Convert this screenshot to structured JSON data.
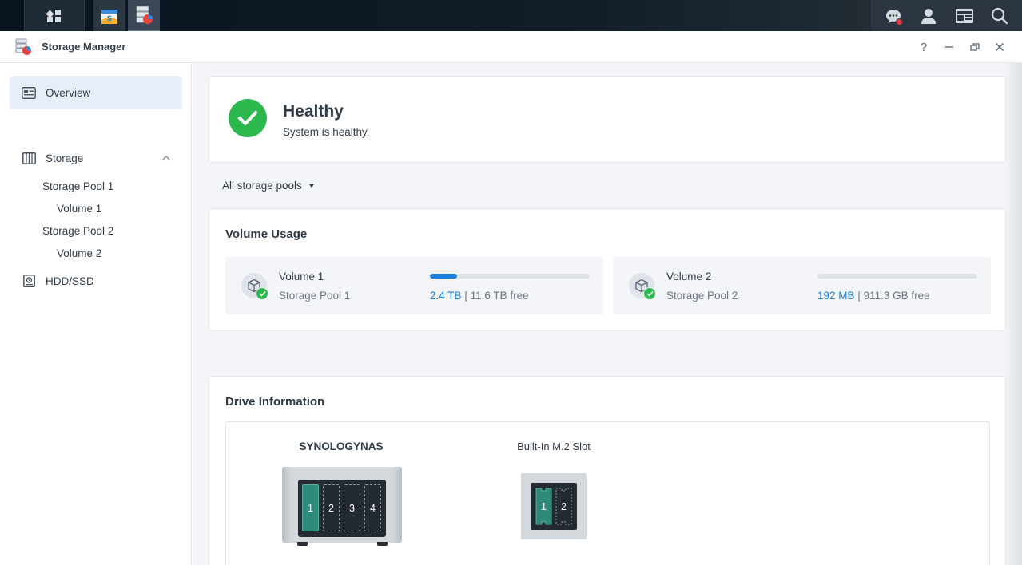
{
  "window": {
    "title": "Storage Manager",
    "controls": {
      "help": "?",
      "minimize": "–",
      "restore": "🗗",
      "close": "✕"
    }
  },
  "sidebar": {
    "items": [
      {
        "label": "Overview",
        "icon": "overview-icon",
        "active": true
      },
      {
        "label": "Storage",
        "icon": "storage-icon",
        "expanded": true
      },
      {
        "label": "Storage Pool 1"
      },
      {
        "label": "Volume 1"
      },
      {
        "label": "Storage Pool 2"
      },
      {
        "label": "Volume 2"
      },
      {
        "label": "HDD/SSD",
        "icon": "hdd-icon"
      }
    ]
  },
  "health": {
    "status": "Healthy",
    "message": "System is healthy.",
    "color": "#2db84d"
  },
  "filter": {
    "label": "All storage pools"
  },
  "volume_usage": {
    "title": "Volume Usage",
    "volumes": [
      {
        "name": "Volume 1",
        "pool": "Storage Pool 1",
        "used": "2.4 TB",
        "separator": "|",
        "free": "11.6 TB free",
        "used_fraction": 0.17
      },
      {
        "name": "Volume 2",
        "pool": "Storage Pool 2",
        "used": "192 MB",
        "separator": "|",
        "free": "911.3 GB free",
        "used_fraction": 0.0
      }
    ],
    "accent_color": "#1b7fe0"
  },
  "drive_info": {
    "title": "Drive Information",
    "nas": {
      "name": "SYNOLOGYNAS",
      "bays": [
        "1",
        "2",
        "3",
        "4"
      ],
      "filled": [
        true,
        false,
        false,
        false
      ]
    },
    "m2": {
      "name": "Built-In M.2 Slot",
      "slots": [
        "1",
        "2"
      ],
      "filled": [
        true,
        false
      ]
    }
  }
}
